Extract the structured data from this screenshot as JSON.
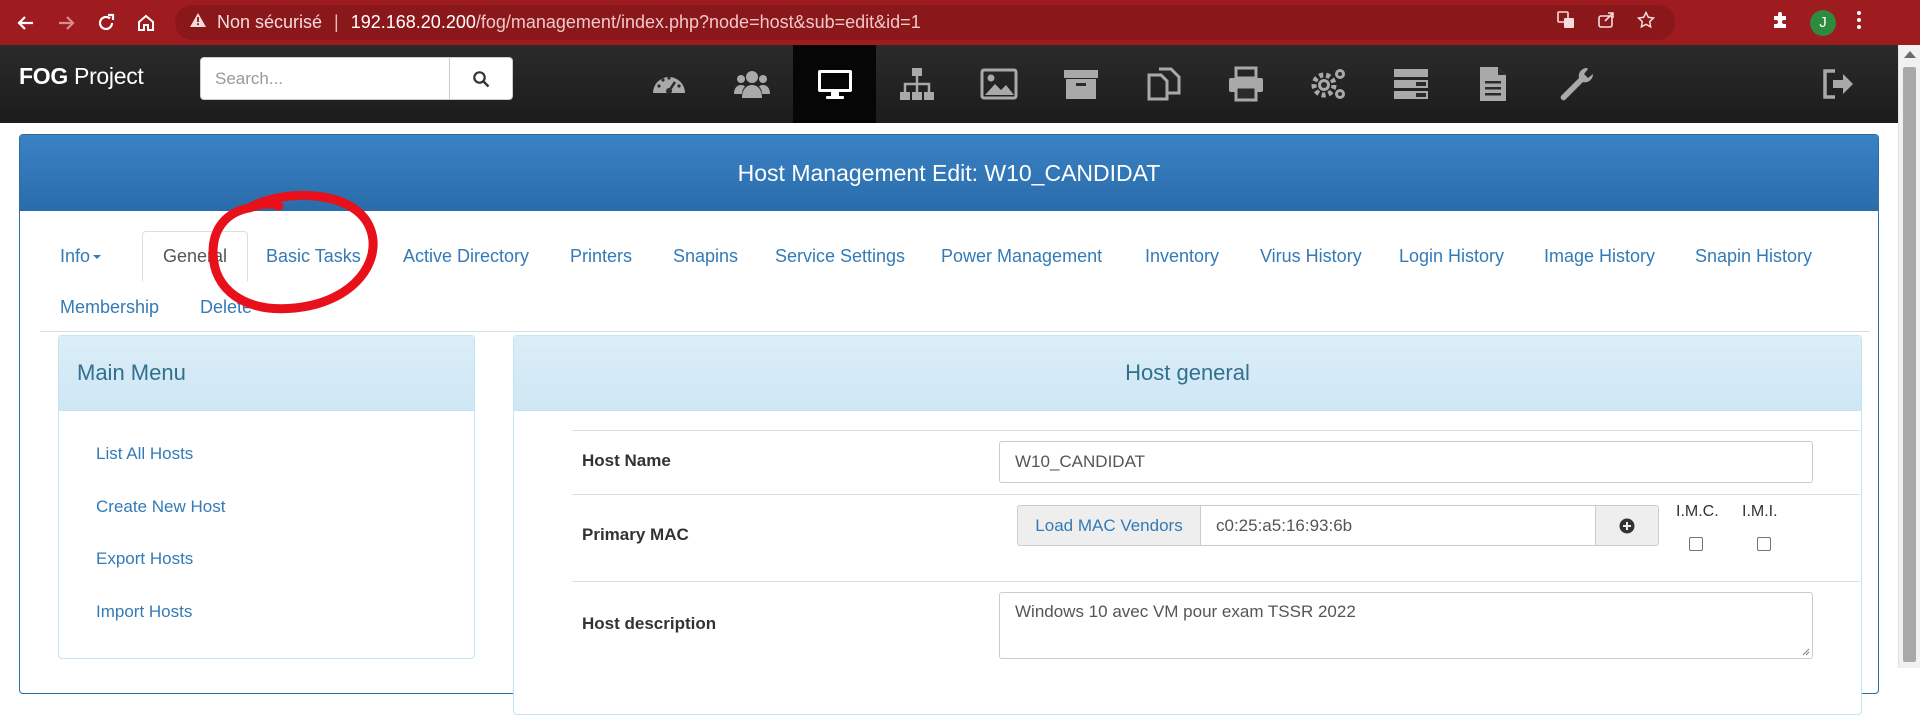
{
  "browser": {
    "security_label": "Non sécurisé",
    "url_host": "192.168.20.200",
    "url_path": "/fog/management/index.php?node=host&sub=edit&id=1",
    "profile_initial": "J"
  },
  "navbar": {
    "brand_bold": "FOG",
    "brand_rest": " Project",
    "search_placeholder": "Search...",
    "icons": [
      "dashboard-icon",
      "users-icon",
      "host-desktop-icon",
      "network-sitemap-icon",
      "image-icon",
      "storage-archive-icon",
      "snapins-copy-icon",
      "printer-icon",
      "service-settings-gears-icon",
      "tasks-server-icon",
      "reports-document-icon",
      "settings-wrench-icon"
    ],
    "active_icon": "host-desktop-icon",
    "logout_icon": "logout-icon"
  },
  "page": {
    "title": "Host Management Edit: W10_CANDIDAT"
  },
  "tabs": [
    {
      "label": "Info",
      "dropdown": true
    },
    {
      "label": "General",
      "active": true
    },
    {
      "label": "Basic Tasks"
    },
    {
      "label": "Active Directory"
    },
    {
      "label": "Printers"
    },
    {
      "label": "Snapins"
    },
    {
      "label": "Service Settings"
    },
    {
      "label": "Power Management"
    },
    {
      "label": "Inventory"
    },
    {
      "label": "Virus History"
    },
    {
      "label": "Login History"
    },
    {
      "label": "Image History"
    },
    {
      "label": "Snapin History"
    },
    {
      "label": "Membership"
    },
    {
      "label": "Delete"
    }
  ],
  "main_menu": {
    "title": "Main Menu",
    "items": [
      "List All Hosts",
      "Create New Host",
      "Export Hosts",
      "Import Hosts"
    ]
  },
  "host_general": {
    "title": "Host general",
    "host_name_label": "Host Name",
    "host_name_value": "W10_CANDIDAT",
    "primary_mac_label": "Primary MAC",
    "load_mac_vendors": "Load MAC Vendors",
    "primary_mac_value": "c0:25:a5:16:93:6b",
    "imc_label": "I.M.C.",
    "imi_label": "I.M.I.",
    "imc_checked": false,
    "imi_checked": false,
    "description_label": "Host description",
    "description_value": "Windows 10 avec VM pour exam TSSR 2022"
  },
  "colors": {
    "browser_bar": "#9e1b1f",
    "link": "#337ab7",
    "panel_heading": "#2a6cab",
    "annotation": "#e8101a"
  }
}
